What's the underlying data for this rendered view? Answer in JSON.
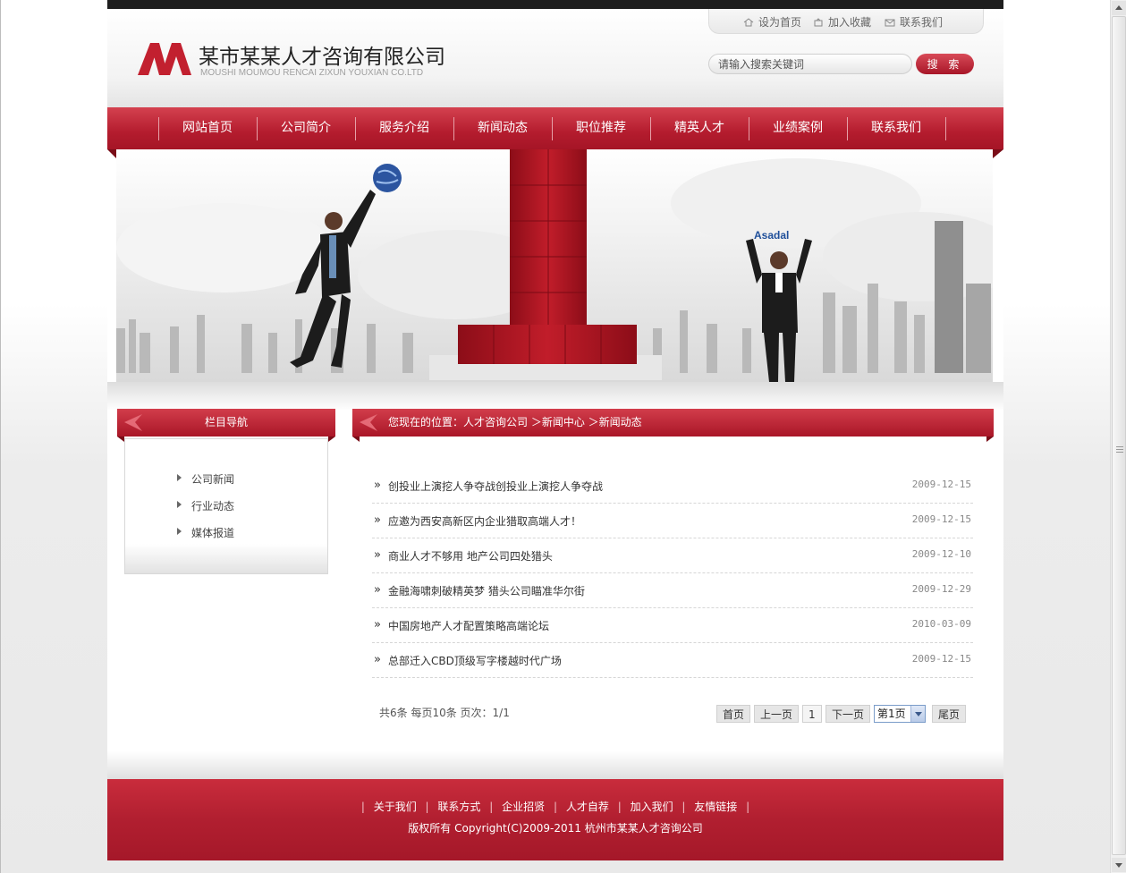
{
  "colors": {
    "brand_red": "#b41c2e",
    "nav_top": "#d4414f",
    "dark_bar": "#1e1e1e"
  },
  "header": {
    "company_name": "某市某某人才咨询有限公司",
    "company_name_en": "MOUSHI MOUMOU RENCAI ZIXUN YOUXIAN CO.LTD",
    "top_links": [
      {
        "label": "设为首页",
        "icon": "home-icon"
      },
      {
        "label": "加入收藏",
        "icon": "favorite-icon"
      },
      {
        "label": "联系我们",
        "icon": "contact-icon"
      }
    ],
    "search": {
      "placeholder": "请输入搜索关键词",
      "button_label": "搜 索"
    }
  },
  "nav": {
    "items": [
      {
        "label": "网站首页"
      },
      {
        "label": "公司简介"
      },
      {
        "label": "服务介绍"
      },
      {
        "label": "新闻动态"
      },
      {
        "label": "职位推荐"
      },
      {
        "label": "精英人才"
      },
      {
        "label": "业绩案例"
      },
      {
        "label": "联系我们"
      }
    ]
  },
  "banner": {
    "sign_text": "Asadal"
  },
  "sidebar": {
    "title": "栏目导航",
    "items": [
      {
        "label": "公司新闻"
      },
      {
        "label": "行业动态"
      },
      {
        "label": "媒体报道"
      }
    ]
  },
  "breadcrumb": {
    "text": "您现在的位置：人才咨询公司 ＞新闻中心 ＞新闻动态"
  },
  "news": {
    "items": [
      {
        "title": "创投业上演挖人争夺战创投业上演挖人争夺战",
        "date": "2009-12-15"
      },
      {
        "title": "应邀为西安高新区内企业猎取高端人才！",
        "date": "2009-12-15"
      },
      {
        "title": "商业人才不够用  地产公司四处猎头",
        "date": "2009-12-10"
      },
      {
        "title": "金融海啸刺破精英梦  猎头公司瞄准华尔街",
        "date": "2009-12-29"
      },
      {
        "title": "中国房地产人才配置策略高端论坛",
        "date": "2010-03-09"
      },
      {
        "title": "总部迁入CBD顶级写字楼越时代广场",
        "date": "2009-12-15"
      }
    ]
  },
  "pager": {
    "info": "共6条  每页10条  页次：1/1",
    "first": "首页",
    "prev": "上一页",
    "current": "1",
    "next": "下一页",
    "page_select": "第1页",
    "last": "尾页"
  },
  "footer": {
    "links": [
      {
        "label": "关于我们"
      },
      {
        "label": "联系方式"
      },
      {
        "label": "企业招贤"
      },
      {
        "label": "人才自荐"
      },
      {
        "label": "加入我们"
      },
      {
        "label": "友情链接"
      }
    ],
    "copyright": "版权所有  Copyright(C)2009-2011 杭州市某某人才咨询公司"
  }
}
